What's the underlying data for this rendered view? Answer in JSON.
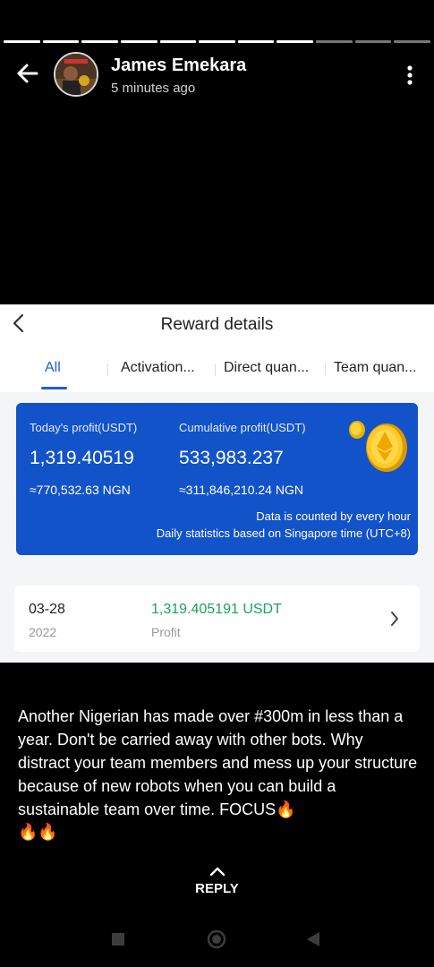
{
  "story": {
    "progress_segments": 11,
    "progress_active": 8,
    "author": "James Emekara",
    "time": "5 minutes ago"
  },
  "screenshot": {
    "title": "Reward details",
    "tabs": [
      "All",
      "Activation...",
      "Direct quan...",
      "Team quan..."
    ],
    "card": {
      "todays_label": "Today's profit(USDT)",
      "todays_value": "1,319.40519",
      "todays_ngn": "≈770,532.63 NGN",
      "cumulative_label": "Cumulative profit(USDT)",
      "cumulative_value": "533,983.237",
      "cumulative_ngn": "≈311,846,210.24 NGN",
      "note_line1": "Data is counted by every hour",
      "note_line2": "Daily statistics based on Singapore time (UTC+8)"
    },
    "record": {
      "date": "03-28",
      "year": "2022",
      "amount": "1,319.405191 USDT",
      "type": "Profit"
    }
  },
  "caption": {
    "text": "Another Nigerian has made over #300m in less than a year. Don't be carried away with other bots. Why distract your team members and mess up your structure because of new robots when you can build a sustainable team over time. FOCUS🔥",
    "emoji_line": "🔥🔥"
  },
  "reply_label": "REPLY",
  "colors": {
    "card_blue": "#1253c9",
    "tab_active": "#1f5fd0",
    "profit_green": "#1aa35a"
  },
  "icons": [
    "arrow-left-icon",
    "more-vertical-icon",
    "chevron-left-icon",
    "coin-icon",
    "chevron-right-icon",
    "chevron-up-icon",
    "nav-square-icon",
    "nav-home-icon",
    "nav-back-icon"
  ]
}
